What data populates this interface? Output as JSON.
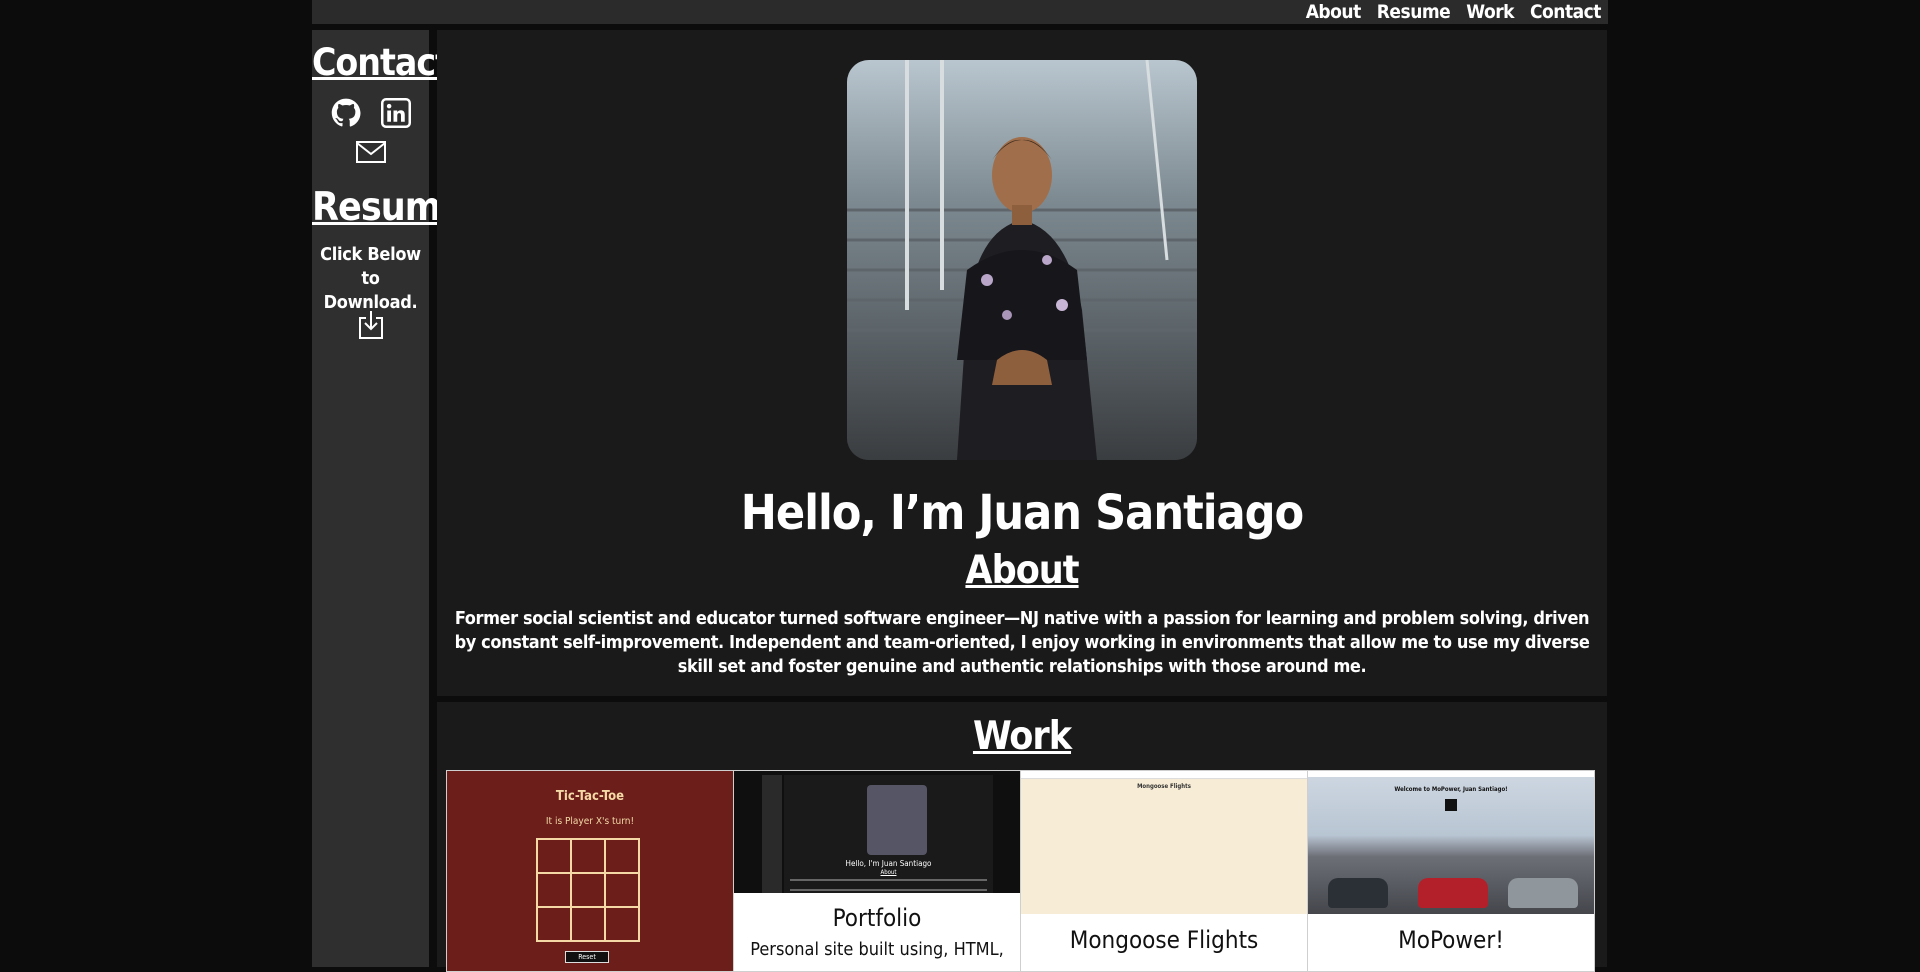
{
  "nav": {
    "items": [
      "About",
      "Resume",
      "Work",
      "Contact"
    ]
  },
  "sidebar": {
    "contact_heading": "Contact",
    "contact_icons": [
      "github-icon",
      "linkedin-icon",
      "mail-icon"
    ],
    "resume_heading": "Resume",
    "resume_text": "Click Below to Download.",
    "download_icon": "download-icon"
  },
  "hero": {
    "greeting": "Hello, I’m Juan Santiago",
    "about_heading": "About",
    "about_text": "Former social scientist and educator turned software engineer—NJ native with a passion for learning and problem solving, driven by constant self-improvement. Independent and team-oriented, I enjoy working in environments that allow me to use my diverse skill set and foster genuine and authentic relationships with those around me."
  },
  "work": {
    "heading": "Work",
    "projects": [
      {
        "title": "",
        "thumb_title": "Tic-Tac-Toe",
        "thumb_turn": "It is Player X's turn!",
        "thumb_button": "Reset"
      },
      {
        "title": "Portfolio",
        "description": "Personal site built using, HTML,",
        "thumb_name": "Hello, I'm Juan Santiago",
        "thumb_section": "About"
      },
      {
        "title": "Mongoose Flights",
        "thumb_title": "Mongoose Flights"
      },
      {
        "title": "MoPower!",
        "thumb_title": "Welcome to MoPower, Juan Santiago!"
      }
    ]
  },
  "colors": {
    "page_bg": "#0c0c0c",
    "panel_bg": "#1a1a1a",
    "sidebar_bg": "#2f2f2f",
    "topbar_bg": "#2b2b2b",
    "ttt_bg": "#6b1e1a"
  }
}
